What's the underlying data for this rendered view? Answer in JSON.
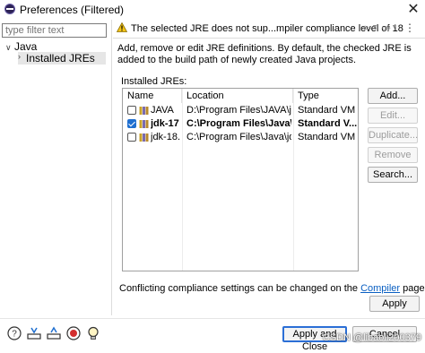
{
  "window": {
    "title": "Preferences (Filtered)",
    "close_glyph": "✕"
  },
  "sidebar": {
    "filter_placeholder": "type filter text",
    "tree": [
      {
        "label": "Java",
        "expanded": true
      },
      {
        "label": "Installed JREs",
        "selected": true
      }
    ]
  },
  "header": {
    "message": "The selected JRE does not sup...mpiler compliance level of 18",
    "icons": [
      "back-arrow-icon",
      "back-dropdown-icon",
      "forward-arrow-icon",
      "forward-dropdown-icon",
      "view-menu-icon"
    ]
  },
  "page": {
    "description": "Add, remove or edit JRE definitions. By default, the checked JRE is added to the build path of newly created Java projects.",
    "jres_label": "Installed JREs:",
    "columns": [
      "Name",
      "Location",
      "Type"
    ],
    "rows": [
      {
        "checked": false,
        "bold": false,
        "name": "JAVA",
        "location": "D:\\Program Files\\JAVA\\jre",
        "type": "Standard VM"
      },
      {
        "checked": true,
        "bold": true,
        "name": "jdk-17 ...",
        "location": "C:\\Program Files\\Java\\jd...",
        "type": "Standard V..."
      },
      {
        "checked": false,
        "bold": false,
        "name": "jdk-18....",
        "location": "C:\\Program Files\\Java\\jdk-...",
        "type": "Standard VM"
      }
    ],
    "buttons": {
      "add": "Add...",
      "edit": "Edit...",
      "duplicate": "Duplicate...",
      "remove": "Remove",
      "search": "Search..."
    },
    "conflict_prefix": "Conflicting compliance settings can be changed on the ",
    "conflict_link": "Compiler",
    "conflict_suffix": " page.",
    "apply": "Apply"
  },
  "footer": {
    "icons": [
      "help-icon",
      "import-icon",
      "export-icon",
      "record-icon",
      "tips-icon"
    ],
    "apply_and_close": "Apply and Close",
    "cancel": "Cancel",
    "watermark": "CSDN @libaoli200379"
  },
  "colors": {
    "accent": "#2b6fd6",
    "link": "#0a5fc2",
    "selection": "#e6e6e6",
    "checkbox": "#1f6fd0",
    "warning": "#f5c518"
  }
}
